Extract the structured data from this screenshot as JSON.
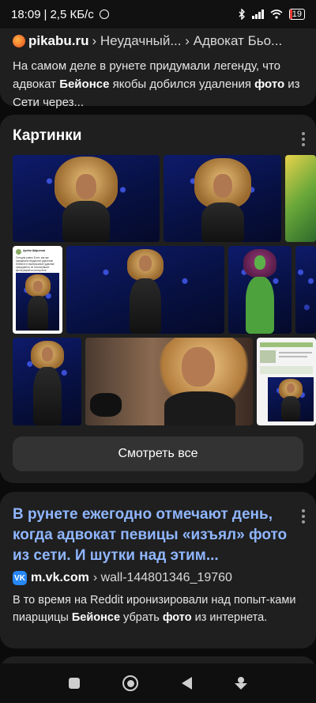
{
  "status": {
    "time": "18:09",
    "speed": "2,5 КБ/с",
    "battery": "19",
    "battery_level": 0.19
  },
  "result1": {
    "domain": "pikabu.ru",
    "path": "› Неудачный... › Адвокат Бьо...",
    "snippet_parts": [
      {
        "t": "На самом деле в рунете придумали легенду, что адвокат ",
        "b": false
      },
      {
        "t": "Бейонсе",
        "b": true
      },
      {
        "t": " якобы добился удаления ",
        "b": false
      },
      {
        "t": "фото",
        "b": true
      },
      {
        "t": " из Сети через...",
        "b": false
      }
    ]
  },
  "images": {
    "title": "Картинки",
    "see_all_label": "Смотреть все",
    "tweet_text": "Сегодня ровно 8 лет, как мы празднуем неудачное удаление Бейонсе и выигрышные удачные прецеденты не исчезнувших фотографий из интернета",
    "tweet_user": "Артём Шаронов"
  },
  "result2": {
    "title": "В рунете ежегодно отмечают день, когда адвокат певицы «изъял» фото из сети. И шутки над этим...",
    "domain": "m.vk.com",
    "path": "› wall-144801346_19760",
    "snippet_parts": [
      {
        "t": "В то время на Reddit иронизировали над попыт-ками пиарщицы ",
        "b": false
      },
      {
        "t": "Бейонсе",
        "b": true
      },
      {
        "t": " убрать ",
        "b": false
      },
      {
        "t": "фото",
        "b": true
      },
      {
        "t": " из интернета.",
        "b": false
      }
    ]
  },
  "colors": {
    "link": "#8fb6ff",
    "card": "#1f1f1f",
    "background": "#0b0b0b",
    "button": "#333333"
  },
  "icons": [
    "alarm-icon",
    "bluetooth-icon",
    "signal-icon",
    "wifi-icon",
    "battery-icon",
    "pikabu-favicon",
    "vk-favicon",
    "menu-dots-icon",
    "nav-recents-icon",
    "nav-home-icon",
    "nav-back-icon",
    "nav-assistant-icon"
  ]
}
